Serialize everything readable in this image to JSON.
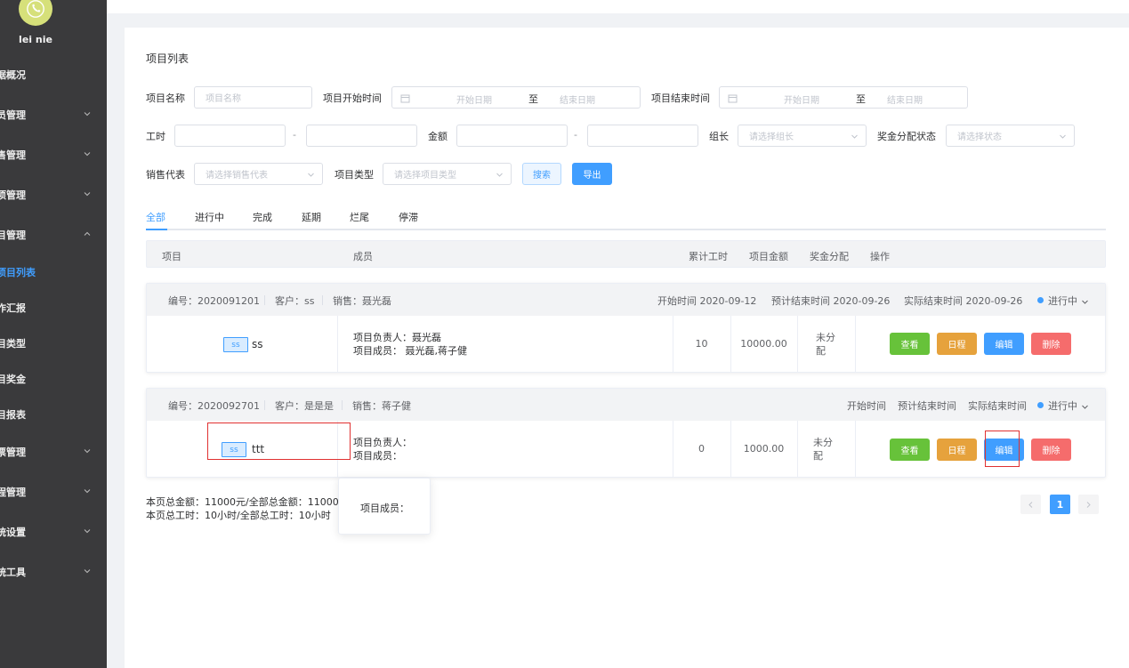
{
  "sidebar": {
    "username": "lei nie",
    "items": [
      {
        "label": "据概况",
        "chevron": false
      },
      {
        "label": "员管理",
        "chevron": true
      },
      {
        "label": "售管理",
        "chevron": true
      },
      {
        "label": "项管理",
        "chevron": true
      },
      {
        "label": "目管理",
        "chevron": true,
        "expanded": true
      },
      {
        "label": "项目列表",
        "sub": true,
        "active": true
      },
      {
        "label": "作汇报",
        "sub": true
      },
      {
        "label": "目类型",
        "sub": true
      },
      {
        "label": "目奖金",
        "sub": true
      },
      {
        "label": "目报表",
        "sub": true
      },
      {
        "label": "票管理",
        "chevron": true
      },
      {
        "label": "程管理",
        "chevron": true
      },
      {
        "label": "统设置",
        "chevron": true
      },
      {
        "label": "统工具",
        "chevron": true
      }
    ]
  },
  "page": {
    "title": "项目列表"
  },
  "filters": {
    "project_name_label": "项目名称",
    "project_name_placeholder": "项目名称",
    "start_time_label": "项目开始时间",
    "end_time_label": "项目结束时间",
    "date_start_placeholder": "开始日期",
    "date_sep": "至",
    "date_end_placeholder": "结束日期",
    "hours_label": "工时",
    "amount_label": "金额",
    "range_sep": "-",
    "leader_label": "组长",
    "leader_placeholder": "请选择组长",
    "bonus_status_label": "奖金分配状态",
    "bonus_status_placeholder": "请选择状态",
    "sales_label": "销售代表",
    "sales_placeholder": "请选择销售代表",
    "type_label": "项目类型",
    "type_placeholder": "请选择项目类型",
    "search_button": "搜索",
    "export_button": "导出"
  },
  "tabs": [
    "全部",
    "进行中",
    "完成",
    "延期",
    "烂尾",
    "停滞"
  ],
  "active_tab": "全部",
  "table_header": {
    "project": "项目",
    "members": "成员",
    "hours": "累计工时",
    "amount": "项目金额",
    "bonus": "奖金分配",
    "actions": "操作"
  },
  "projects": [
    {
      "code": "编号：2020091201",
      "client": "客户：ss",
      "sales": "销售：聂光磊",
      "start": "开始时间 2020-09-12",
      "planned_end": "预计结束时间 2020-09-26",
      "actual_end": "实际结束时间 2020-09-26",
      "status": "进行中",
      "tag": "ss",
      "name": "ss",
      "leader": "项目负责人：聂光磊",
      "members": "项目成员： 聂光磊,蒋子健",
      "hours": "10",
      "amount": "10000.00",
      "bonus_line1": "未分",
      "bonus_line2": "配"
    },
    {
      "code": "编号：2020092701",
      "client": "客户：是是是",
      "sales": "销售：蒋子健",
      "start": "开始时间",
      "planned_end": "预计结束时间",
      "actual_end": "实际结束时间",
      "status": "进行中",
      "tag": "ss",
      "name": "ttt",
      "leader": "项目负责人：",
      "members": "项目成员：",
      "hours": "0",
      "amount": "1000.00",
      "bonus_line1": "未分",
      "bonus_line2": "配"
    }
  ],
  "actions": {
    "view": "查看",
    "schedule": "日程",
    "edit": "编辑",
    "delete": "删除"
  },
  "totals": {
    "amount_line": "本页总金额：11000元/全部总金额：11000",
    "hours_line": "本页总工时：10小时/全部总工时：10小时"
  },
  "popover": {
    "text": "项目成员："
  },
  "pagination": {
    "current": "1"
  }
}
